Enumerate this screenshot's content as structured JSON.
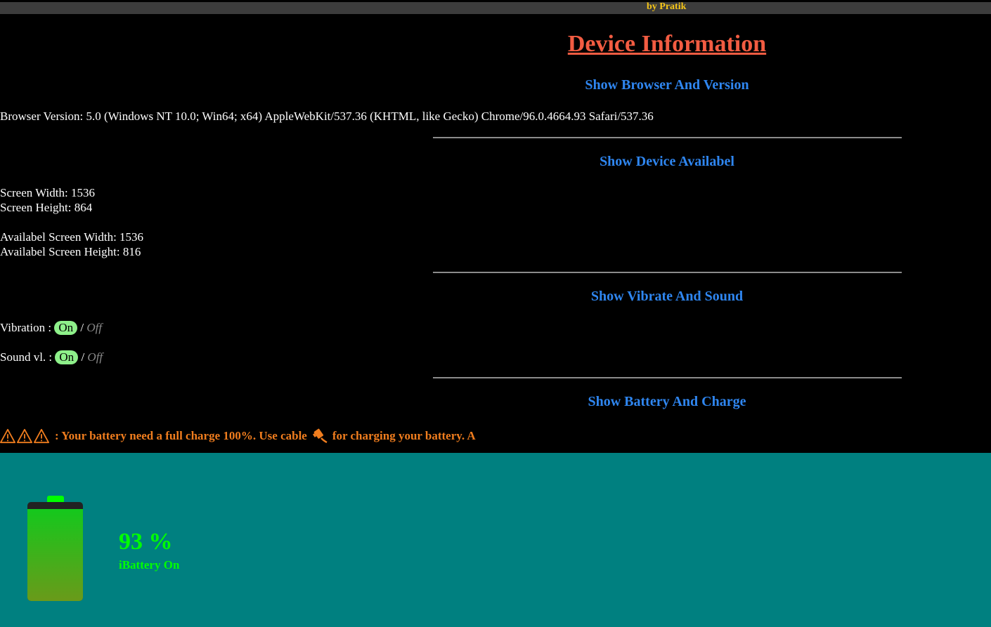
{
  "banner": {
    "author": "by Pratik"
  },
  "title": "Device Information",
  "sections": {
    "browser": {
      "heading": "Show Browser And Version",
      "line": "Browser Version: 5.0 (Windows NT 10.0; Win64; x64) AppleWebKit/537.36 (KHTML, like Gecko) Chrome/96.0.4664.93 Safari/537.36"
    },
    "device": {
      "heading": "Show Device Availabel",
      "screen_width": "Screen Width: 1536",
      "screen_height": "Screen Height: 864",
      "avail_width": "Availabel Screen Width: 1536",
      "avail_height": "Availabel Screen Height: 816"
    },
    "vibrate": {
      "heading": "Show Vibrate And Sound",
      "vibration_label": "Vibration :",
      "sound_label": "Sound vl. :",
      "on": "On",
      "slash": "/",
      "off": "Off"
    },
    "battery": {
      "heading": "Show Battery And Charge",
      "warning_text": ": Your battery need a full charge 100%. Use cable",
      "warning_text_2": "for charging your battery. A",
      "percent": "93 %",
      "level": 0.93,
      "status": "iBattery On"
    }
  },
  "colors": {
    "title": "#f25c42",
    "heading": "#2f86f0",
    "warning": "#f07d1e",
    "panel": "#008080",
    "battery_green": "#00ff00",
    "pill_on": "#8ef08a"
  },
  "icons": {
    "warning": "warning-triangle-icon",
    "cable": "cable-plug-icon"
  }
}
